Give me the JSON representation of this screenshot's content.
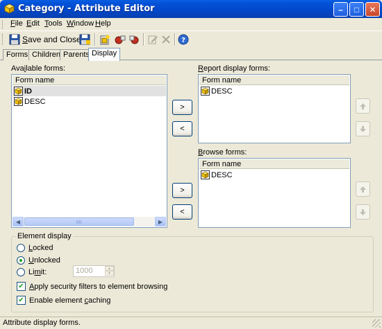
{
  "window": {
    "title": "Category - Attribute Editor",
    "minimize_glyph": "–",
    "maximize_glyph": "□",
    "close_glyph": "✕"
  },
  "menu": [
    {
      "key": "F",
      "rest": "ile"
    },
    {
      "key": "E",
      "rest": "dit"
    },
    {
      "key": "T",
      "rest": "ools"
    },
    {
      "key": "W",
      "rest": "indow"
    },
    {
      "key": "H",
      "rest": "elp"
    }
  ],
  "toolbar": {
    "save_close_key": "S",
    "save_close_rest": "ave and Close",
    "icons": [
      "save-icon",
      "new-form-icon",
      "add-forms-icon",
      "remove-forms-icon",
      "edit-disabled-icon",
      "delete-disabled-icon",
      "help-icon"
    ]
  },
  "tabs": [
    {
      "label": "Forms",
      "active": false
    },
    {
      "label": "Children",
      "active": false
    },
    {
      "label": "Parents",
      "active": false
    },
    {
      "label": "Display",
      "active": true
    }
  ],
  "available_forms": {
    "label_pre": "Ava",
    "label_key": "i",
    "label_post": "lable forms:",
    "column": "Form name",
    "rows": [
      {
        "name": "ID",
        "selected": true,
        "bold": true
      },
      {
        "name": "DESC",
        "selected": false,
        "bold": false
      }
    ]
  },
  "report_display_forms": {
    "label_key": "R",
    "label_rest": "eport display forms:",
    "column": "Form name",
    "rows": [
      {
        "name": "DESC"
      }
    ]
  },
  "browse_forms": {
    "label_key": "B",
    "label_rest": "rowse forms:",
    "column": "Form name",
    "rows": [
      {
        "name": "DESC"
      }
    ]
  },
  "buttons": {
    "add": ">",
    "remove": "<"
  },
  "element_display": {
    "title": "Element display",
    "locked": {
      "key": "L",
      "rest": "ocked",
      "selected": false
    },
    "unlocked": {
      "key": "U",
      "rest": "nlocked",
      "selected": true
    },
    "limit": {
      "pre": "Li",
      "key": "m",
      "post": "it:",
      "selected": false,
      "value": "1000"
    },
    "security_filters": {
      "key": "A",
      "rest": "pply security filters to element browsing",
      "checked": true
    },
    "caching": {
      "pre": "Enable element ",
      "key": "c",
      "post": "aching",
      "checked": true
    }
  },
  "status": "Attribute display forms.",
  "colors": {
    "titlebar": "#0251d8",
    "selection": "#e1e1e1",
    "radio_dot": "#21a121",
    "cube_icon": "#f2c200"
  }
}
